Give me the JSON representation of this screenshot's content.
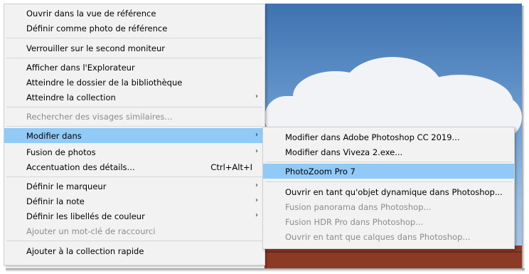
{
  "main_menu": {
    "items": [
      {
        "label": "Ouvrir dans la vue de référence"
      },
      {
        "label": "Définir comme photo de référence"
      },
      {
        "label": "Verrouiller sur le second moniteur"
      },
      {
        "label": "Afficher dans l'Explorateur"
      },
      {
        "label": "Atteindre le dossier de la bibliothèque"
      },
      {
        "label": "Atteindre la collection",
        "submenu": true
      },
      {
        "label": "Rechercher des visages similaires...",
        "disabled": true
      },
      {
        "label": "Modifier dans",
        "submenu": true,
        "highlighted": true
      },
      {
        "label": "Fusion de photos",
        "submenu": true
      },
      {
        "label": "Accentuation des détails...",
        "shortcut": "Ctrl+Alt+I"
      },
      {
        "label": "Définir le marqueur",
        "submenu": true
      },
      {
        "label": "Définir la note",
        "submenu": true
      },
      {
        "label": "Définir les libellés de couleur",
        "submenu": true
      },
      {
        "label": "Ajouter un mot-clé de raccourci",
        "disabled": true
      },
      {
        "label": "Ajouter à la collection rapide"
      }
    ],
    "submenu_arrow": "›"
  },
  "sub_menu": {
    "items": [
      {
        "label": "Modifier dans Adobe Photoshop CC 2019..."
      },
      {
        "label": "Modifier dans Viveza 2.exe..."
      },
      {
        "label": "PhotoZoom Pro 7",
        "highlighted": true
      },
      {
        "label": "Ouvrir en tant qu'objet dynamique dans Photoshop..."
      },
      {
        "label": "Fusion panorama dans Photoshop...",
        "disabled": true
      },
      {
        "label": "Fusion HDR Pro dans Photoshop...",
        "disabled": true
      },
      {
        "label": "Ouvrir en tant que calques dans Photoshop...",
        "disabled": true
      }
    ]
  },
  "colors": {
    "highlight": "#91c9f7",
    "menu_bg": "#f2f2f2",
    "disabled_text": "#8c8c8c"
  }
}
